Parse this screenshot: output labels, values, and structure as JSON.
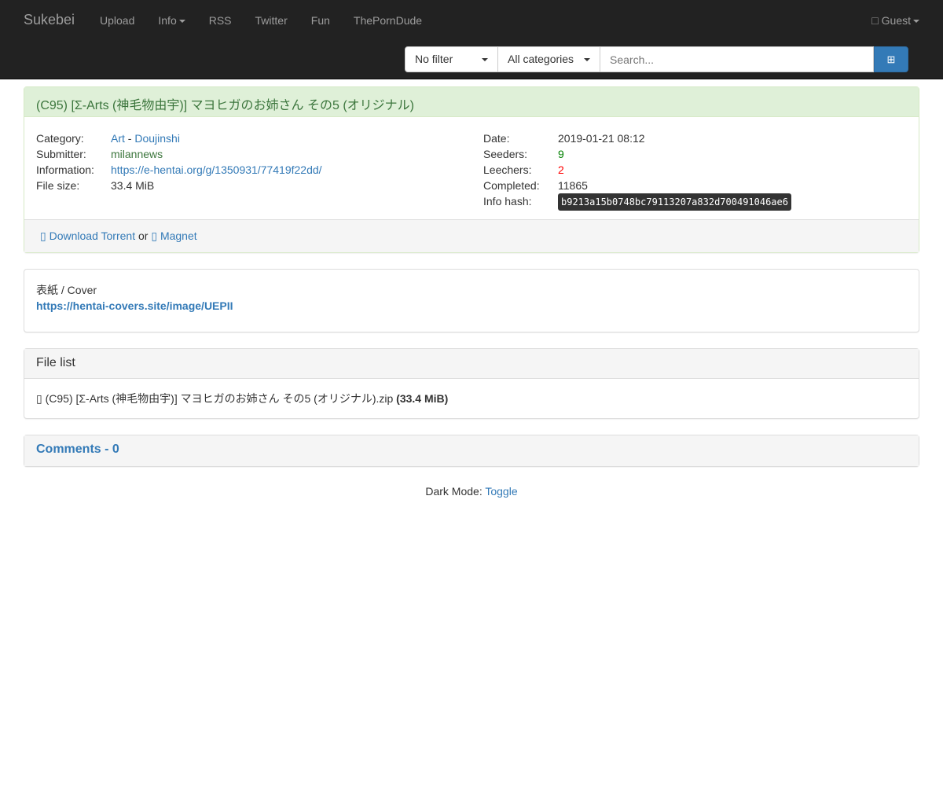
{
  "nav": {
    "brand": "Sukebei",
    "links": [
      "Upload",
      "Info",
      "RSS",
      "Twitter",
      "Fun",
      "ThePornDude"
    ],
    "user_icon": "user-icon",
    "user": "Guest"
  },
  "search": {
    "filter": "No filter",
    "category": "All categories",
    "placeholder": "Search...",
    "button_icon": "search-icon"
  },
  "torrent": {
    "title": "(C95) [Σ-Arts (神毛物由宇)] マヨヒガのお姉さん その5 (オリジナル)",
    "category_label": "Category:",
    "category_main": "Art",
    "category_sep": " - ",
    "category_sub": "Doujinshi",
    "submitter_label": "Submitter:",
    "submitter": "milannews",
    "information_label": "Information:",
    "information": "https://e-hentai.org/g/1350931/77419f22dd/",
    "filesize_label": "File size:",
    "filesize": "33.4 MiB",
    "date_label": "Date:",
    "date": "2019-01-21 08:12",
    "seeders_label": "Seeders:",
    "seeders": "9",
    "leechers_label": "Leechers:",
    "leechers": "2",
    "completed_label": "Completed:",
    "completed": "11865",
    "hash_label": "Info hash:",
    "hash": "b9213a15b0748bc79113207a832d700491046ae6",
    "download": "Download Torrent",
    "or": " or ",
    "magnet": "Magnet"
  },
  "description": {
    "line1": "表紙 / Cover",
    "link": "https://hentai-covers.site/image/UEPII"
  },
  "filelist": {
    "title": "File list",
    "file": "(C95) [Σ-Arts (神毛物由宇)] マヨヒガのお姉さん その5 (オリジナル).zip",
    "size": "(33.4 MiB)"
  },
  "comments": {
    "title": "Comments - 0"
  },
  "footer": {
    "label": "Dark Mode: ",
    "toggle": "Toggle"
  },
  "colors": {
    "navbar": "#222222",
    "accent": "#337ab7",
    "success_bg": "#dff0d8",
    "seeders": "#008000",
    "leechers": "#ff0000"
  }
}
